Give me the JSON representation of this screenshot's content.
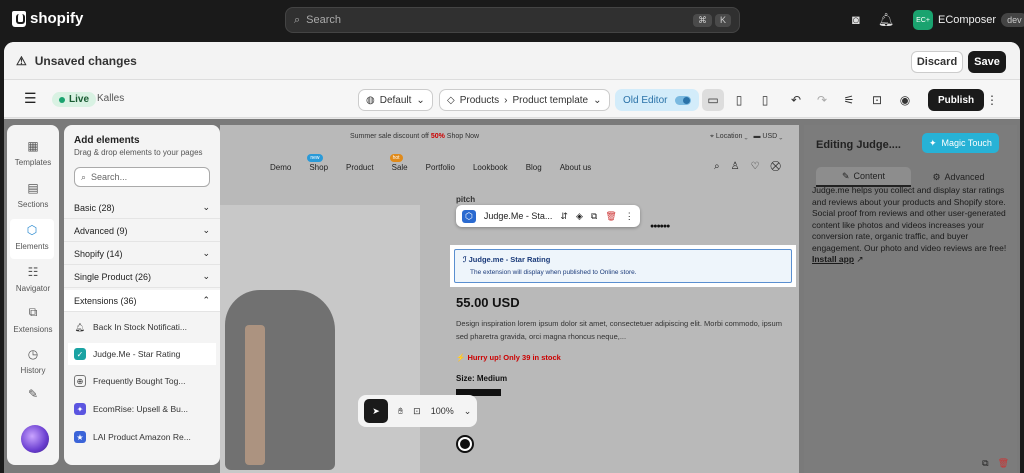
{
  "topbar": {
    "brand": "shopify",
    "search_placeholder": "Search",
    "kbd": [
      "⌘",
      "K"
    ],
    "user": "EComposer",
    "user_initials": "EC+",
    "env": "dev"
  },
  "unsaved": {
    "text": "Unsaved changes",
    "discard": "Discard",
    "save": "Save"
  },
  "toolbar": {
    "live": "Live",
    "theme": "Kalles",
    "language": "Default",
    "products": "Products",
    "template": "Product template",
    "old_editor": "Old Editor",
    "publish": "Publish"
  },
  "rail": [
    {
      "label": "Templates",
      "icon": "templates-icon"
    },
    {
      "label": "Sections",
      "icon": "sections-icon"
    },
    {
      "label": "Elements",
      "icon": "elements-icon"
    },
    {
      "label": "Navigator",
      "icon": "navigator-icon"
    },
    {
      "label": "Extensions",
      "icon": "extensions-icon"
    },
    {
      "label": "History",
      "icon": "history-icon"
    }
  ],
  "panel": {
    "title": "Add elements",
    "subtitle": "Drag & drop elements to your pages",
    "search_placeholder": "Search...",
    "categories": [
      "Basic (28)",
      "Advanced (9)",
      "Shopify (14)",
      "Single Product (26)",
      "Extensions (36)"
    ],
    "extensions": [
      "Back In Stock Notificati...",
      "Judge.Me - Star Rating",
      "Frequently Bought Tog...",
      "EcomRise: Upsell & Bu...",
      "LAI Product Amazon Re..."
    ]
  },
  "canvas": {
    "promo_text": "Summer sale discount off ",
    "promo_percent": "50%",
    "promo_link": "Shop Now",
    "location": "Location",
    "currency": "USD",
    "nav": [
      "Demo",
      "Shop",
      "Product",
      "Sale",
      "Portfolio",
      "Lookbook",
      "Blog",
      "About us"
    ],
    "badge_shop": "new",
    "badge_sale": "hot",
    "toolbar_label": "Judge.Me - Sta...",
    "jm_title": "Judge.me - Star Rating",
    "jm_desc": "The extension will display when published to Online store.",
    "price": "55.00 USD",
    "description": "Design inspiration lorem ipsum dolor sit amet, consectetuer adipiscing elit. Morbi commodo, ipsum sed pharetra gravida, orci magna rhoncus neque,...",
    "hurry": "Hurry up! Only 39 in stock",
    "size_label": "Size: Medium",
    "heading_fragment": "pitch",
    "rating_dots": "●●●●●●"
  },
  "zoom": {
    "value": "100%"
  },
  "right": {
    "title": "Editing Judge....",
    "magic": "Magic Touch",
    "tab_content": "Content",
    "tab_advanced": "Advanced",
    "description": "Judge.me helps you collect and display star ratings and reviews about your products and Shopify store. Social proof from reviews and other user-generated content like photos and videos increases your conversion rate, organic traffic, and buyer engagement. Our photo and video reviews are free!",
    "install": "Install app"
  }
}
